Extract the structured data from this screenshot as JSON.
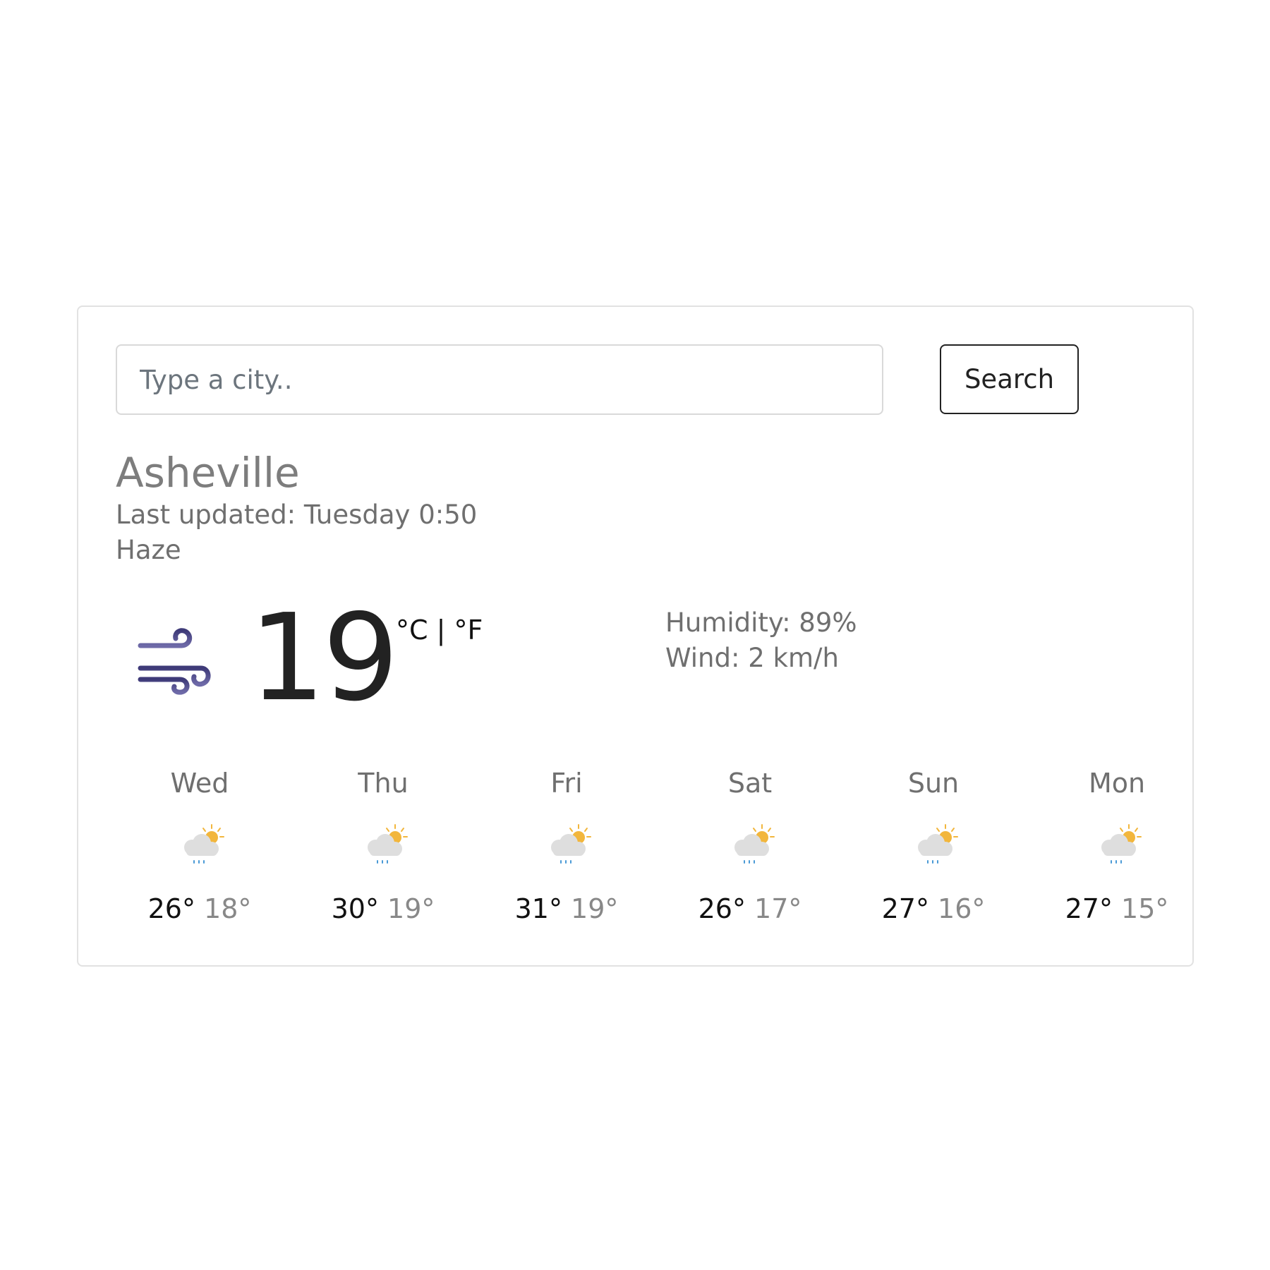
{
  "search": {
    "placeholder": "Type a city..",
    "value": "",
    "button_label": "Search"
  },
  "current": {
    "city": "Asheville",
    "last_updated": "Last updated: Tuesday 0:50",
    "description": "Haze",
    "icon": "wind-icon",
    "temperature": "19",
    "unit_celsius": "°C",
    "unit_separator": " | ",
    "unit_fahrenheit": "°F",
    "humidity": "Humidity: 89%",
    "wind": "Wind: 2 km/h"
  },
  "forecast": [
    {
      "day": "Wed",
      "icon": "partly-cloudy-rain-icon",
      "max": "26°",
      "min": "18°"
    },
    {
      "day": "Thu",
      "icon": "partly-cloudy-rain-icon",
      "max": "30°",
      "min": "19°"
    },
    {
      "day": "Fri",
      "icon": "partly-cloudy-rain-icon",
      "max": "31°",
      "min": "19°"
    },
    {
      "day": "Sat",
      "icon": "partly-cloudy-rain-icon",
      "max": "26°",
      "min": "17°"
    },
    {
      "day": "Sun",
      "icon": "partly-cloudy-rain-icon",
      "max": "27°",
      "min": "16°"
    },
    {
      "day": "Mon",
      "icon": "partly-cloudy-rain-icon",
      "max": "27°",
      "min": "15°"
    }
  ],
  "colors": {
    "wind_icon": "#4a4585",
    "sun": "#f2b63c",
    "cloud": "#dcdcdc",
    "rain": "#4a9ad6"
  }
}
